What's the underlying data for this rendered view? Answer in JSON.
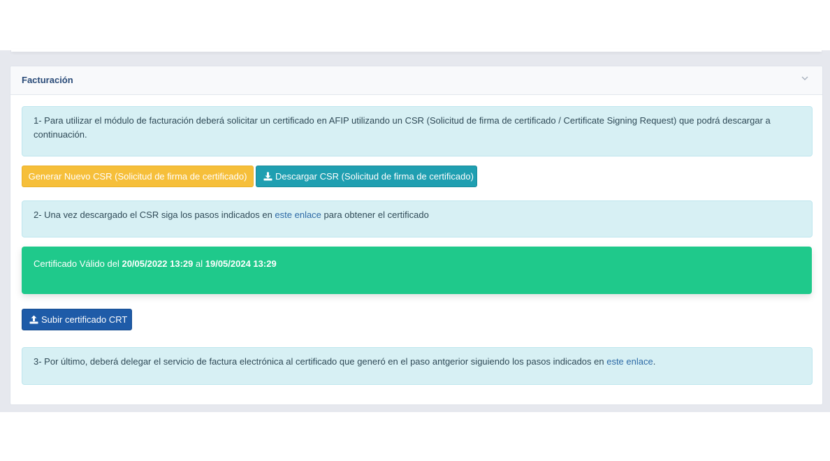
{
  "card": {
    "title": "Facturación"
  },
  "step1": {
    "text": "1- Para utilizar el módulo de facturación deberá solicitar un certificado en AFIP utilizando un CSR (Solicitud de firma de certificado / Certificate Signing Request) que podrá descargar a continuación."
  },
  "buttons": {
    "generate_csr": "Generar Nuevo CSR (Solicitud de firma de certificado)",
    "download_csr": "Descargar CSR (Solicitud de firma de certificado)",
    "upload_crt": "Subir certificado CRT"
  },
  "step2": {
    "before": "2- Una vez descargado el CSR siga los pasos indicados en ",
    "link": "este enlace",
    "after": " para obtener el certificado"
  },
  "certificate": {
    "prefix": "Certificado Válido del ",
    "from": "20/05/2022 13:29",
    "middle": " al ",
    "to": "19/05/2024 13:29"
  },
  "step3": {
    "before": "3- Por último, deberá delegar el servicio de factura electrónica al certificado que generó en el paso antgerior siguiendo los pasos indicados en ",
    "link": "este enlace",
    "after": "."
  },
  "colors": {
    "warning": "#f6bf3a",
    "info": "#1f9fb1",
    "primary": "#1e5ba8",
    "success": "#1fc98b",
    "alert_bg": "#d7f0f4"
  },
  "icons": {
    "collapse": "chevron-down-icon",
    "download": "download-icon",
    "upload": "upload-icon"
  }
}
